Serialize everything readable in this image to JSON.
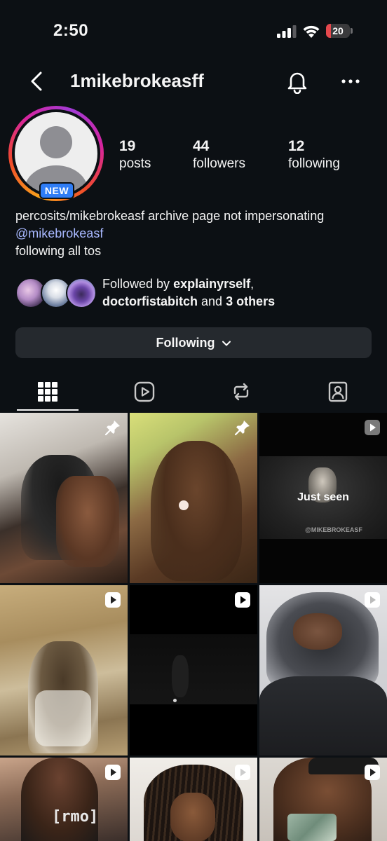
{
  "status_bar": {
    "time": "2:50",
    "battery_level": "20",
    "battery_color": "#e5484d",
    "icons": [
      "signal-icon",
      "wifi-icon",
      "battery-icon"
    ]
  },
  "header": {
    "username": "1mikebrokeasff",
    "icons": [
      "back-chevron-icon",
      "bell-icon",
      "more-icon"
    ]
  },
  "profile": {
    "new_badge": "NEW",
    "stats": [
      {
        "num": "19",
        "label": "posts"
      },
      {
        "num": "44",
        "label": "followers"
      },
      {
        "num": "12",
        "label": "following"
      }
    ],
    "bio_line1": "percosits/mikebrokeasf archive page not impersonating",
    "bio_link": "@mikebrokeasf",
    "bio_line3": "following all tos",
    "link_color": "#a8b8ff"
  },
  "followed_by": {
    "prefix": "Followed by ",
    "user1": "explainyrself",
    "comma": ",",
    "user2": "doctorfistabitch",
    "and": " and ",
    "others": "3 others"
  },
  "following_button": {
    "label": "Following"
  },
  "tabs": [
    {
      "name": "grid-icon",
      "active": true
    },
    {
      "name": "reels-icon",
      "active": false
    },
    {
      "name": "reposts-icon",
      "active": false
    },
    {
      "name": "tagged-icon",
      "active": false
    }
  ],
  "grid": {
    "overlay_text": "Just seen",
    "watermark": "@MIKEBROKEASF",
    "shirt_text": "[rmo]",
    "posts": [
      {
        "badge": "pin-icon"
      },
      {
        "badge": "pin-icon"
      },
      {
        "badge": "reel-icon"
      },
      {
        "badge": "reel-icon"
      },
      {
        "badge": "reel-icon"
      },
      {
        "badge": "reel-icon"
      },
      {
        "badge": "reel-icon"
      },
      {
        "badge": "reel-icon"
      },
      {
        "badge": "reel-icon"
      }
    ]
  }
}
